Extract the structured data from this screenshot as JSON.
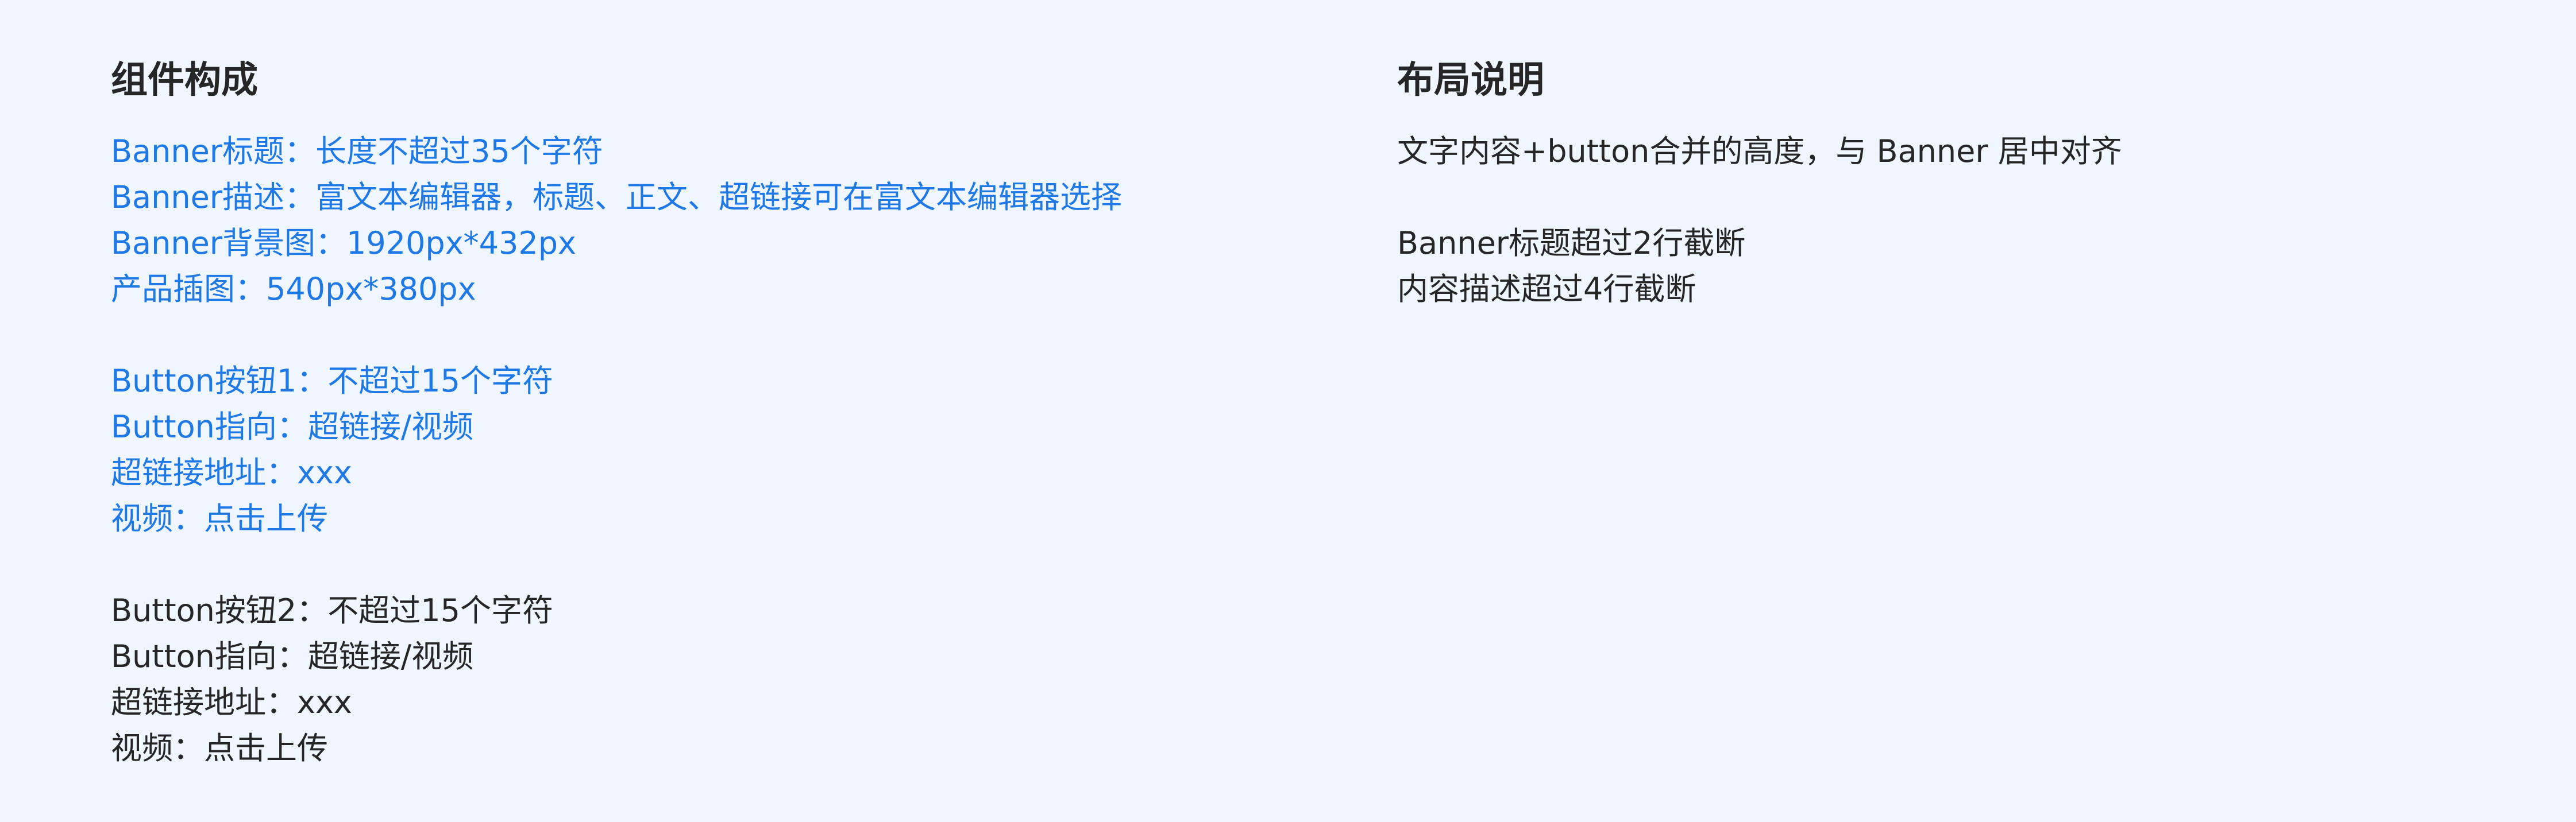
{
  "colors": {
    "background": "#eff6ff",
    "accent": "#1e78e6",
    "text": "#262626"
  },
  "left": {
    "heading": "组件构成",
    "group1": [
      "Banner标题：长度不超过35个字符",
      "Banner描述：富文本编辑器，标题、正文、超链接可在富文本编辑器选择",
      "Banner背景图：1920px*432px",
      "产品插图：540px*380px"
    ],
    "group2": [
      "Button按钮1：不超过15个字符",
      "Button指向：超链接/视频",
      "超链接地址：xxx",
      "视频：点击上传"
    ],
    "group3": [
      "Button按钮2：不超过15个字符",
      "Button指向：超链接/视频",
      "超链接地址：xxx",
      "视频：点击上传"
    ]
  },
  "right": {
    "heading": "布局说明",
    "group1": [
      "文字内容+button合并的高度，与 Banner 居中对齐"
    ],
    "group2": [
      "Banner标题超过2行截断",
      "内容描述超过4行截断"
    ]
  }
}
